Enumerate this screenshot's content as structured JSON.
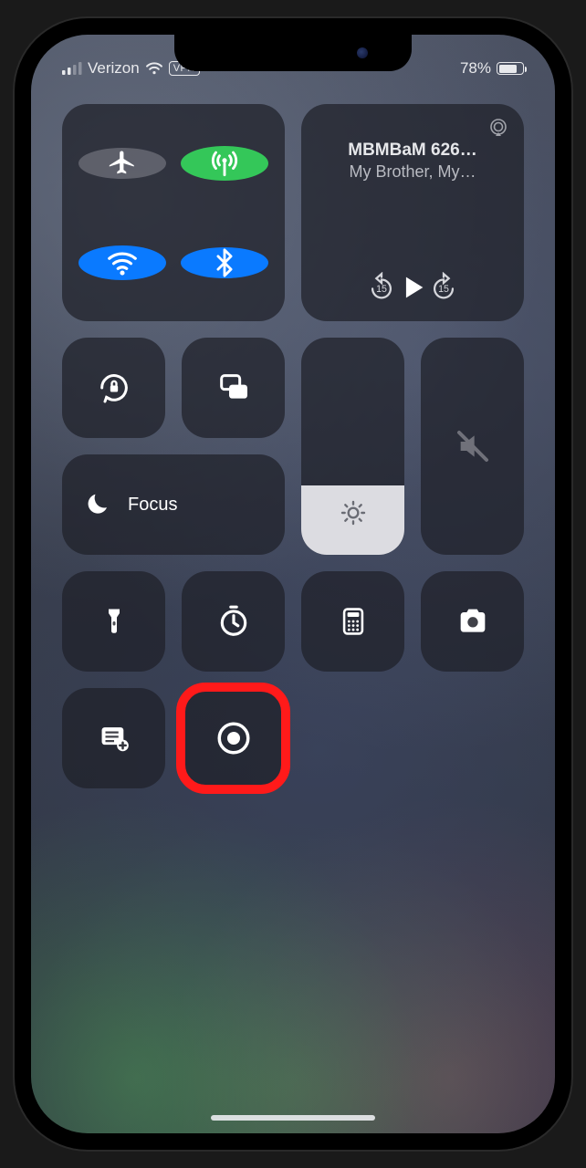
{
  "status": {
    "carrier": "Verizon",
    "vpn_label": "VPN",
    "battery_percent_text": "78%",
    "battery_percent_value": 78
  },
  "connectivity": {
    "airplane": {
      "name": "airplane-mode",
      "active": false
    },
    "cellular": {
      "name": "cellular-data",
      "active": true
    },
    "wifi": {
      "name": "wifi",
      "active": true
    },
    "bluetooth": {
      "name": "bluetooth",
      "active": true
    }
  },
  "media": {
    "title": "MBMBaM 626…",
    "subtitle": "My Brother, My…",
    "back_seconds": "15",
    "forward_seconds": "15"
  },
  "focus": {
    "label": "Focus"
  },
  "brightness": {
    "value_percent": 32
  },
  "volume": {
    "value_percent": 0,
    "muted": true
  },
  "tiles": {
    "orientation_lock": "orientation-lock",
    "screen_mirroring": "screen-mirroring",
    "flashlight": "flashlight",
    "timer": "timer",
    "calculator": "calculator",
    "camera": "camera",
    "notes": "quick-note",
    "screen_record": "screen-recording"
  },
  "annotation": {
    "highlight_target": "screen-recording"
  }
}
